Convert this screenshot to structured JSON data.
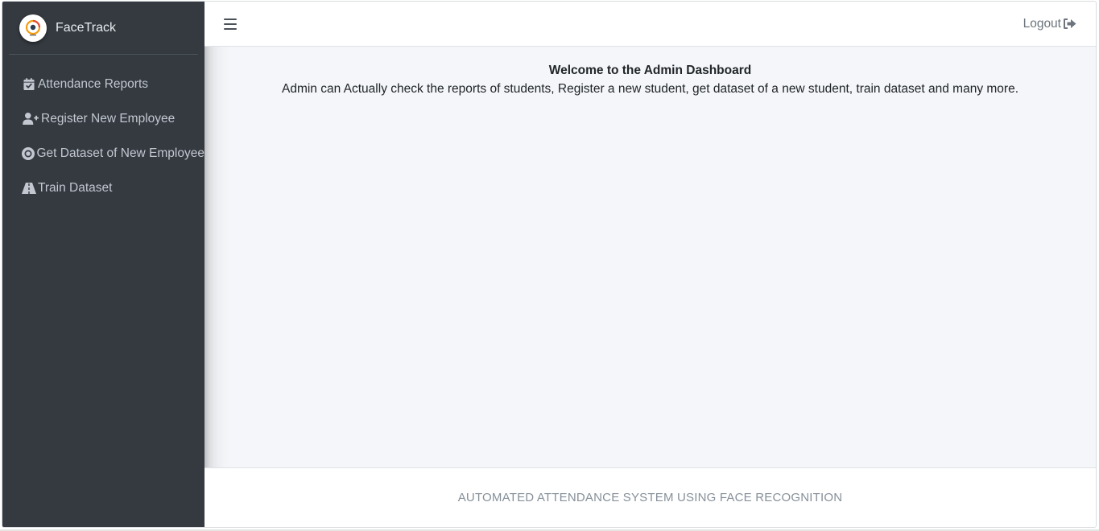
{
  "brand": {
    "name": "FaceTrack",
    "logo_icon": "facetrack-logo-icon"
  },
  "sidebar": {
    "items": [
      {
        "label": "Attendance Reports",
        "icon": "calendar-check-icon"
      },
      {
        "label": "Register New Employee",
        "icon": "user-plus-icon"
      },
      {
        "label": "Get Dataset of New Employee",
        "icon": "dot-circle-icon"
      },
      {
        "label": "Train Dataset",
        "icon": "road-icon"
      }
    ]
  },
  "navbar": {
    "toggle_icon": "hamburger-menu-icon",
    "logout_label": "Logout",
    "logout_icon": "sign-out-icon"
  },
  "main": {
    "title": "Welcome to the Admin Dashboard",
    "description": "Admin can Actually check the reports of students, Register a new student, get dataset of a new student, train dataset and many more."
  },
  "footer": {
    "text": "AUTOMATED ATTENDANCE SYSTEM USING FACE RECOGNITION"
  },
  "colors": {
    "sidebar_bg": "#343a40",
    "content_bg": "#f4f6f9",
    "sidebar_text": "#c2c7d0",
    "footer_text": "#869099"
  }
}
